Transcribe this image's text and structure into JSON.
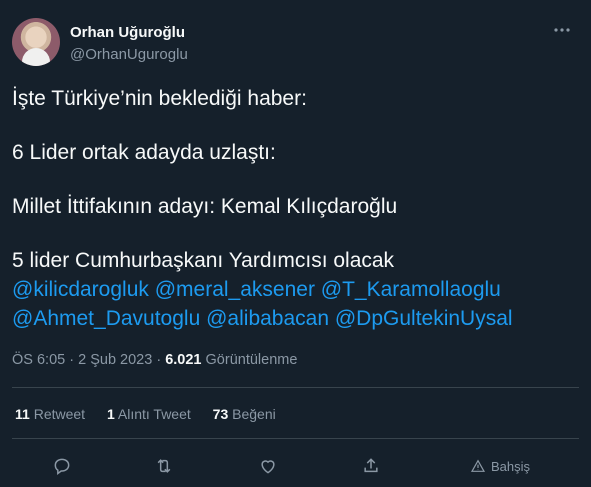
{
  "author": {
    "name": "Orhan Uğuroğlu",
    "handle": "@OrhanUguroglu"
  },
  "tweet": {
    "line1": "İşte Türkiye’nin beklediği haber:",
    "line2": "6 Lider ortak adayda uzlaştı:",
    "line3": "Millet İttifakının adayı: Kemal Kılıçdaroğlu",
    "line4": "5 lider Cumhurbaşkanı Yardımcısı olacak",
    "mentions": [
      "@kilicdarogluk",
      "@meral_aksener",
      "@T_Karamollaoglu",
      "@Ahmet_Davutoglu",
      "@alibabacan",
      "@DpGultekinUysal"
    ]
  },
  "meta": {
    "time": "ÖS 6:05",
    "separator": "·",
    "date": "2 Şub 2023",
    "views_count": "6.021",
    "views_label": "Görüntülenme"
  },
  "stats": {
    "retweets": "11",
    "retweets_label": "Retweet",
    "quotes": "1",
    "quotes_label": "Alıntı Tweet",
    "likes": "73",
    "likes_label": "Beğeni"
  },
  "actions": {
    "tip_label": "Bahşiş"
  },
  "icons": {
    "more": "more-icon",
    "reply": "reply-icon",
    "retweet": "retweet-icon",
    "like": "heart-icon",
    "share": "share-icon",
    "tip": "tip-icon"
  },
  "colors": {
    "background": "#15202b",
    "text": "#f7f9f9",
    "muted": "#8b98a5",
    "link": "#1d9bf0",
    "divider": "#38444d"
  }
}
